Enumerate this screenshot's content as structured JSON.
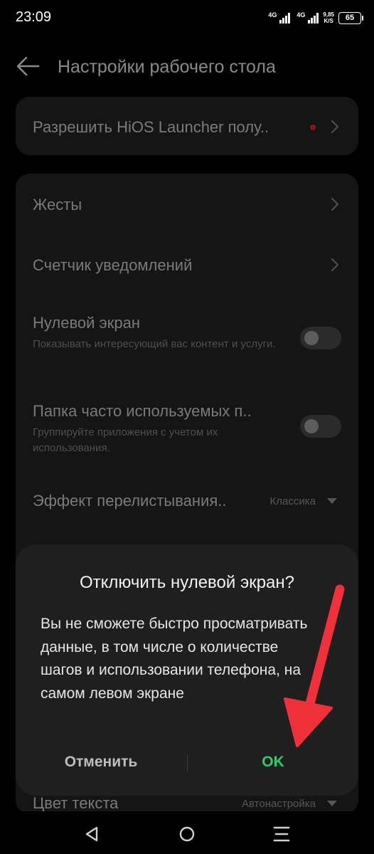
{
  "status": {
    "time": "23:09",
    "net1": "4G",
    "net2": "4G",
    "speed_value": "9,85",
    "speed_unit": "K/S",
    "battery": "65"
  },
  "header": {
    "title": "Настройки рабочего стола"
  },
  "permission": {
    "label": "Разрешить HiOS Launcher полу.."
  },
  "settings": {
    "gestures": "Жесты",
    "badge_counter": "Счетчик уведомлений",
    "zero_screen": {
      "label": "Нулевой экран",
      "sub": "Показывать интересующий вас контент и услуги.",
      "enabled": false
    },
    "frequent_folder": {
      "label": "Папка часто используемых п..",
      "sub": "Группируйте приложения с учетом их использования.",
      "enabled": false
    },
    "scroll_effect": {
      "label": "Эффект перелистывания..",
      "value": "Классика"
    },
    "text_color": {
      "label": "Цвет текста",
      "value": "Автонастройка"
    }
  },
  "dialog": {
    "title": "Отключить нулевой экран?",
    "message": "Вы не сможете быстро просматривать данные, в том числе о количестве шагов и использовании телефона, на самом левом экране",
    "cancel": "Отменить",
    "ok": "OK"
  },
  "colors": {
    "ok_accent": "#2ecc71",
    "arrow": "#f0303a",
    "notification_dot": "#8b1414"
  },
  "icons": [
    "back-arrow-icon",
    "chevron-right-icon",
    "dropdown-caret-icon",
    "nav-back-icon",
    "nav-home-icon",
    "nav-recents-icon"
  ]
}
